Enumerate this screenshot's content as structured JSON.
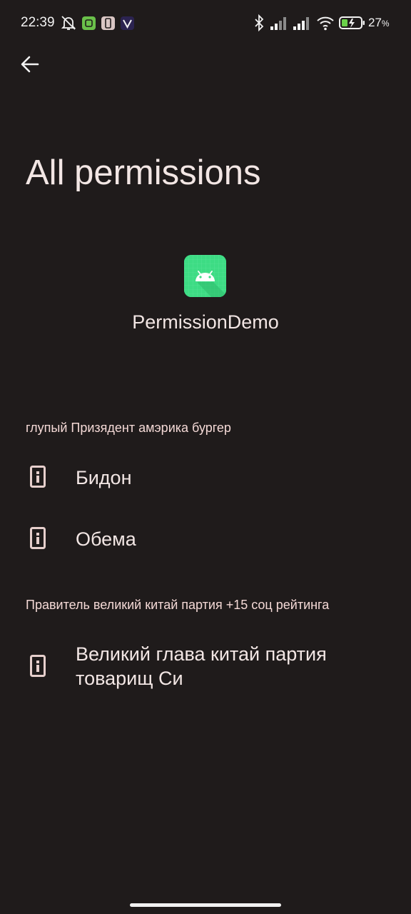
{
  "status_bar": {
    "time": "22:39",
    "battery_percent": "27",
    "percent_sign": "%"
  },
  "header": {
    "title": "All permissions"
  },
  "app": {
    "name": "PermissionDemo",
    "icon": "android-app-icon",
    "icon_bg": "#3ddc84"
  },
  "groups": [
    {
      "header": "глупый Призядент амэрика бургер",
      "items": [
        {
          "label": "Бидон",
          "icon": "info-icon"
        },
        {
          "label": "Обема",
          "icon": "info-icon"
        }
      ]
    },
    {
      "header": "Правитель великий китай партия +15 соц рейтинга",
      "items": [
        {
          "label_line1": "Великий глава китай партия",
          "label_line2": "товарищ Си",
          "icon": "info-icon"
        }
      ]
    }
  ],
  "colors": {
    "background": "#1f1b1b",
    "text": "#f2e6e4",
    "section_header": "#f4d9d6",
    "icon_fill": "#e6cfcc"
  }
}
